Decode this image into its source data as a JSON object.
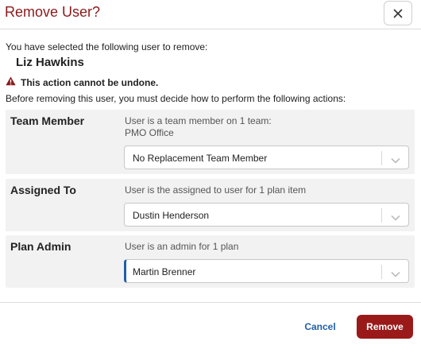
{
  "dialog": {
    "title": "Remove User?",
    "intro": "You have selected the following user to remove:",
    "user_name": "Liz Hawkins",
    "warning": "This action cannot be undone.",
    "instructions": "Before removing this user, you must decide how to perform the following actions:"
  },
  "rows": [
    {
      "label": "Team Member",
      "description": "User is a team member on 1 team:",
      "detail": "PMO Office",
      "selected": "No Replacement Team Member"
    },
    {
      "label": "Assigned To",
      "description": "User is the assigned to user for 1 plan item",
      "selected": "Dustin Henderson"
    },
    {
      "label": "Plan Admin",
      "description": "User is an admin for 1 plan",
      "selected": "Martin Brenner"
    }
  ],
  "footer": {
    "cancel_label": "Cancel",
    "remove_label": "Remove"
  },
  "colors": {
    "title": "#8b1a1a",
    "primary_action": "#9a1a1a",
    "link": "#1f5fa8",
    "warning_icon": "#8b1a1a",
    "row_background": "#f2f2f2"
  },
  "icons": {
    "close": "close-icon",
    "warning": "warning-icon",
    "select": "chevron-down-icon"
  }
}
